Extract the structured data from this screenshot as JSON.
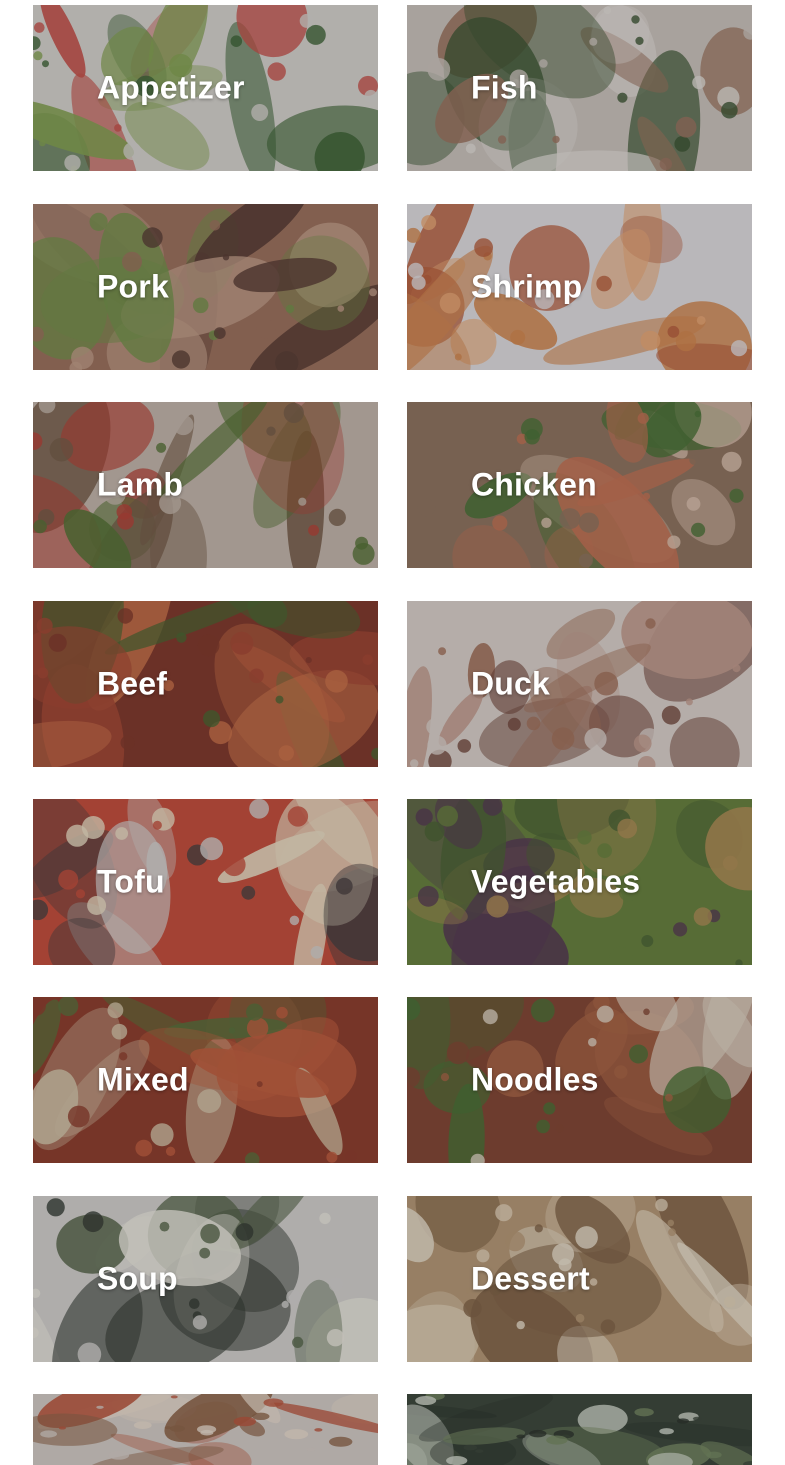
{
  "categories": [
    {
      "label": "Appetizer",
      "icon": "appetizer-photo",
      "colors": [
        "#dcd8cf",
        "#2f5b23",
        "#7fa143",
        "#c9463a"
      ]
    },
    {
      "label": "Fish",
      "icon": "fish-photo",
      "colors": [
        "#cfc7bc",
        "#2d4a1f",
        "#9a6d52",
        "#e9e3da"
      ]
    },
    {
      "label": "Pork",
      "icon": "pork-photo",
      "colors": [
        "#9a6a50",
        "#4f2f22",
        "#6c8f3b",
        "#c49b80"
      ]
    },
    {
      "label": "Shrimp",
      "icon": "shrimp-photo",
      "colors": [
        "#e7e3e3",
        "#d7823f",
        "#b8542a",
        "#f1a86b"
      ]
    },
    {
      "label": "Lamb",
      "icon": "lamb-photo",
      "colors": [
        "#c7b8a8",
        "#6e5238",
        "#4b6c24",
        "#b83425"
      ]
    },
    {
      "label": "Chicken",
      "icon": "chicken-photo",
      "colors": [
        "#8b6d53",
        "#3f6b25",
        "#c76a45",
        "#e3c5ae"
      ]
    },
    {
      "label": "Beef",
      "icon": "beef-photo",
      "colors": [
        "#7a2a18",
        "#a43b22",
        "#3f5c1f",
        "#d06c3a"
      ]
    },
    {
      "label": "Duck",
      "icon": "duck-photo",
      "colors": [
        "#e1d6cc",
        "#a0694c",
        "#6c3b2b",
        "#c59a87"
      ]
    },
    {
      "label": "Tofu",
      "icon": "tofu-photo",
      "colors": [
        "#c8422a",
        "#f2e3c3",
        "#3d3330",
        "#d8d5d0"
      ]
    },
    {
      "label": "Vegetables",
      "icon": "vegetables-photo",
      "colors": [
        "#5f7c2d",
        "#4b2d44",
        "#b08a48",
        "#3e5a22"
      ]
    },
    {
      "label": "Mixed",
      "icon": "mixed-photo",
      "colors": [
        "#8a3019",
        "#c4552e",
        "#d9c8a6",
        "#4d6a2a"
      ]
    },
    {
      "label": "Noodles",
      "icon": "noodles-photo",
      "colors": [
        "#7d3a22",
        "#3d6a24",
        "#a85b34",
        "#e5d8c3"
      ]
    },
    {
      "label": "Soup",
      "icon": "soup-photo",
      "colors": [
        "#d8d6cf",
        "#262d21",
        "#f2efe1",
        "#4b5c39"
      ]
    },
    {
      "label": "Dessert",
      "icon": "dessert-photo",
      "colors": [
        "#b8966c",
        "#e8d7b8",
        "#7b5a37",
        "#f2e7cf"
      ]
    },
    {
      "label": "",
      "icon": "rice-photo",
      "colors": [
        "#d9d0c6",
        "#bb4a2b",
        "#f1e2cf",
        "#8a5c3a"
      ]
    },
    {
      "label": "",
      "icon": "drink-photo",
      "colors": [
        "#2e3b2a",
        "#6e8456",
        "#d9e0cf",
        "#1b2418"
      ]
    }
  ]
}
